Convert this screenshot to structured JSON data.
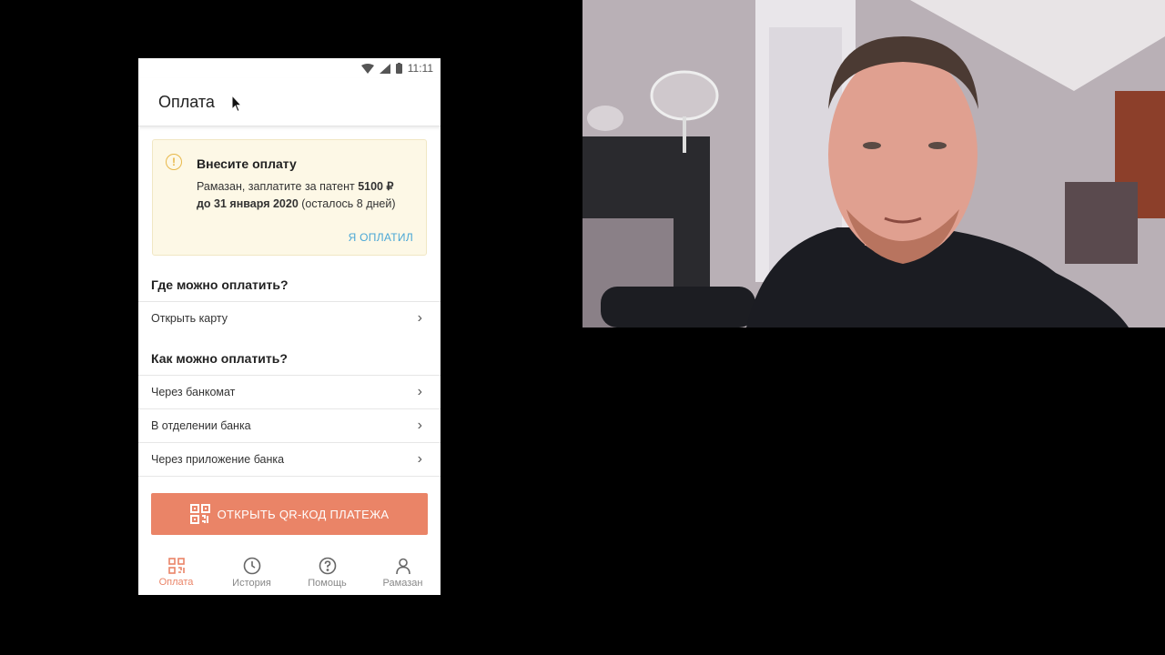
{
  "status_bar": {
    "time": "11:11"
  },
  "app_bar": {
    "title": "Оплата"
  },
  "notice": {
    "title": "Внесите оплату",
    "text_prefix": "Рамазан, заплатите за патент ",
    "amount": "5100 ₽",
    "deadline": "до 31 января 2020",
    "remaining": " (осталось 8 дней)",
    "action": "Я ОПЛАТИЛ",
    "icon": "warning-icon"
  },
  "where_section": {
    "title": "Где можно оплатить?",
    "items": [
      {
        "label": "Открыть карту"
      }
    ]
  },
  "how_section": {
    "title": "Как можно оплатить?",
    "items": [
      {
        "label": "Через банкомат"
      },
      {
        "label": "В отделении банка"
      },
      {
        "label": "Через приложение банка"
      }
    ]
  },
  "qr_button": {
    "label": "ОТКРЫТЬ QR-КОД ПЛАТЕЖА",
    "icon": "qr-code-icon"
  },
  "bottom_nav": {
    "items": [
      {
        "label": "Оплата",
        "icon": "qr-code-icon",
        "active": true
      },
      {
        "label": "История",
        "icon": "clock-icon"
      },
      {
        "label": "Помощь",
        "icon": "help-circle-icon"
      },
      {
        "label": "Рамазан",
        "icon": "profile-icon"
      }
    ]
  },
  "colors": {
    "accent": "#ea8467",
    "link": "#4aa7d6",
    "notice_bg": "#fdf8e6",
    "warning": "#e8b84a"
  }
}
